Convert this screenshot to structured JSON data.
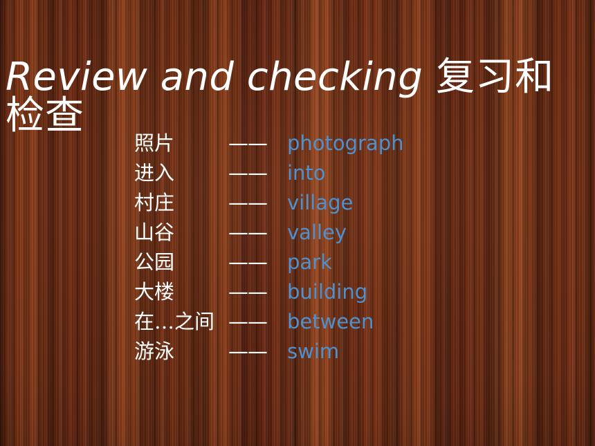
{
  "slide": {
    "background": {
      "style": "wood-grain",
      "base_color": "#7a2e12",
      "dark_grain_color": "#5a2410",
      "light_grain_color": "#a0441e"
    },
    "title": {
      "english": "Review and checking",
      "chinese": "复习和检查",
      "color": "#ffffff"
    },
    "vocabulary": {
      "separator": "——",
      "chinese_color": "#ffffff",
      "english_color": "#4f90ce",
      "rows": [
        {
          "chinese": "照片",
          "english": "photograph"
        },
        {
          "chinese": "进入",
          "english": "into"
        },
        {
          "chinese": "村庄",
          "english": "village"
        },
        {
          "chinese": "山谷",
          "english": "valley"
        },
        {
          "chinese": "公园",
          "english": "park"
        },
        {
          "chinese": "大楼",
          "english": "building"
        },
        {
          "chinese": "在…之间",
          "english": "between"
        },
        {
          "chinese": "游泳",
          "english": "swim"
        }
      ]
    }
  }
}
